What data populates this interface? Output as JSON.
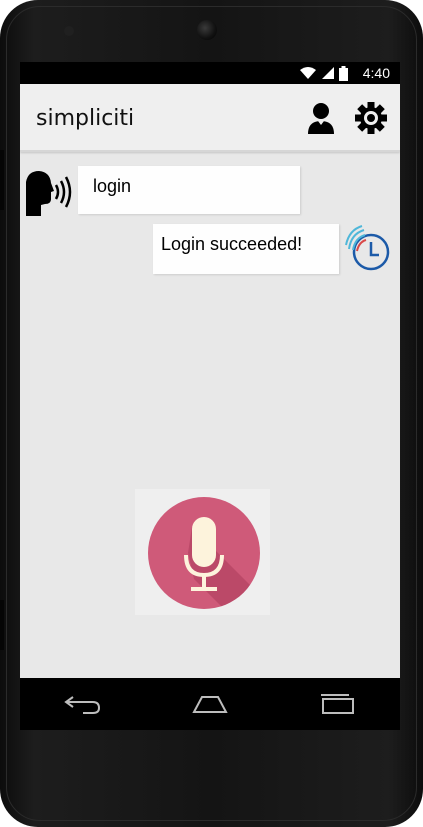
{
  "status": {
    "time": "4:40"
  },
  "appbar": {
    "title": "simpliciti",
    "profile_icon": "user-icon",
    "settings_icon": "gear-icon"
  },
  "conversation": [
    {
      "sender": "user",
      "text": "login",
      "avatar_icon": "speaking-head-icon"
    },
    {
      "sender": "assistant",
      "text": "Login succeeded!",
      "avatar_icon": "assistant-logo-icon"
    }
  ],
  "mic": {
    "icon": "microphone-icon",
    "accent": "#cf5a79"
  },
  "nav": {
    "back_icon": "back-icon",
    "home_icon": "home-icon",
    "recents_icon": "recents-icon"
  },
  "colors": {
    "screen_bg": "#e8e8e8",
    "appbar_bg": "#efefef",
    "bubble_bg": "#fefefe",
    "device": "#141414"
  }
}
